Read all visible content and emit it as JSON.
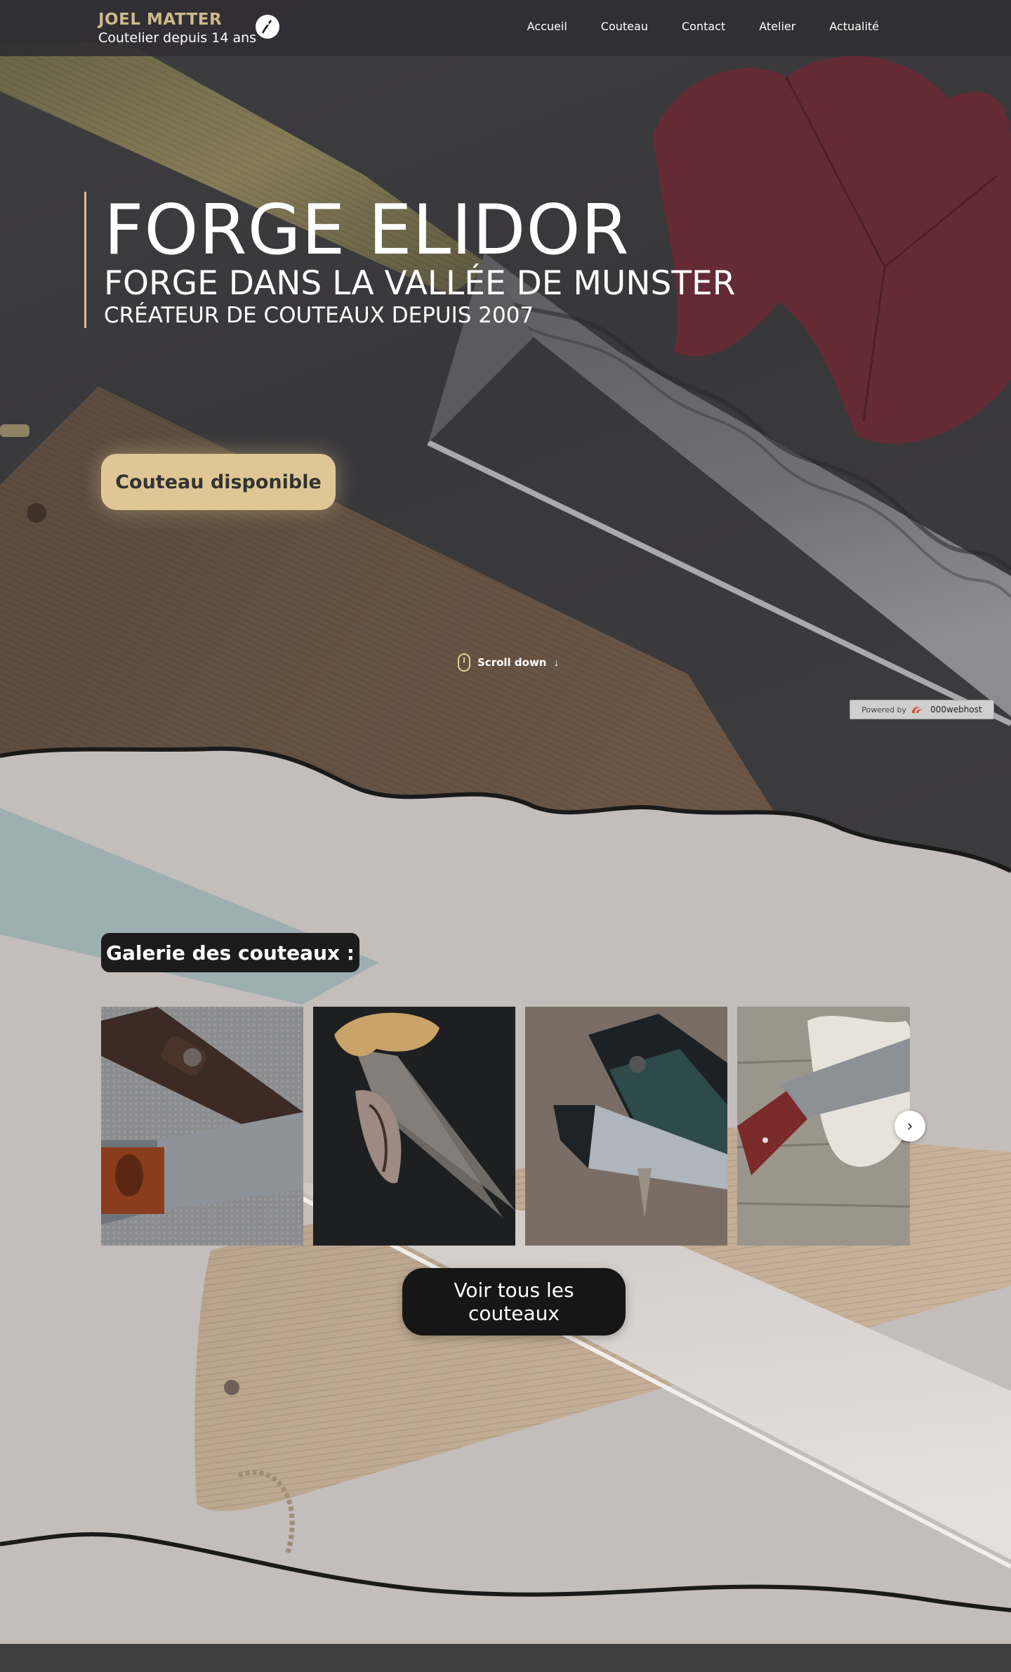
{
  "header": {
    "brand_name": "JOEL MATTER",
    "brand_tagline": "Coutelier depuis 14 ans",
    "logo_icon": "knife-logo-icon",
    "nav": [
      {
        "label": "Accueil"
      },
      {
        "label": "Couteau"
      },
      {
        "label": "Contact"
      },
      {
        "label": "Atelier"
      },
      {
        "label": "Actualité"
      }
    ]
  },
  "hero": {
    "title": "FORGE ELIDOR",
    "subtitle": "FORGE DANS LA VALLÉE DE MUNSTER",
    "subtitle2": "CRÉATEUR DE COUTEAUX DEPUIS 2007",
    "cta_label": "Couteau disponible",
    "scroll_label": "Scroll down",
    "scroll_icon": "mouse-icon",
    "powered_by": "Powered by",
    "host_name": "000webhost"
  },
  "gallery": {
    "title": "Galerie des couteaux :",
    "images": [
      {
        "name": "knife-photo-1"
      },
      {
        "name": "knife-photo-2"
      },
      {
        "name": "knife-photo-3"
      },
      {
        "name": "knife-photo-4"
      }
    ],
    "next_icon": "chevron-right-icon",
    "cta_label": "Voir tous les couteaux"
  },
  "colors": {
    "accent": "#dfc795",
    "brand_gold": "#cdb98d",
    "dark_button": "#161616",
    "hero_bg": "#3b3a3c",
    "gallery_bg": "#c3bdbc"
  }
}
